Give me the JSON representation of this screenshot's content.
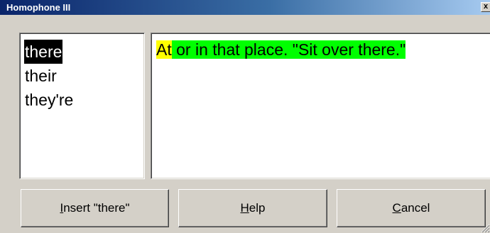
{
  "window": {
    "title": "Homophone III",
    "close_glyph": "x"
  },
  "word_list": {
    "items": [
      {
        "label": "there",
        "selected": true
      },
      {
        "label": "their",
        "selected": false
      },
      {
        "label": "they're",
        "selected": false
      }
    ]
  },
  "definition": {
    "highlight_word": "At",
    "rest": " or in that place. \"Sit over there.\"",
    "highlight_word_color": "#ffff00",
    "highlight_rest_color": "#00ff00"
  },
  "buttons": {
    "insert": {
      "mnemonic": "I",
      "rest": "nsert \"there\""
    },
    "help": {
      "mnemonic": "H",
      "rest": "elp"
    },
    "cancel": {
      "mnemonic": "C",
      "rest": "ancel"
    }
  },
  "colors": {
    "face": "#d4d0c8",
    "title_start": "#0a246a",
    "title_end": "#a6caf0",
    "selection": "#000000"
  }
}
